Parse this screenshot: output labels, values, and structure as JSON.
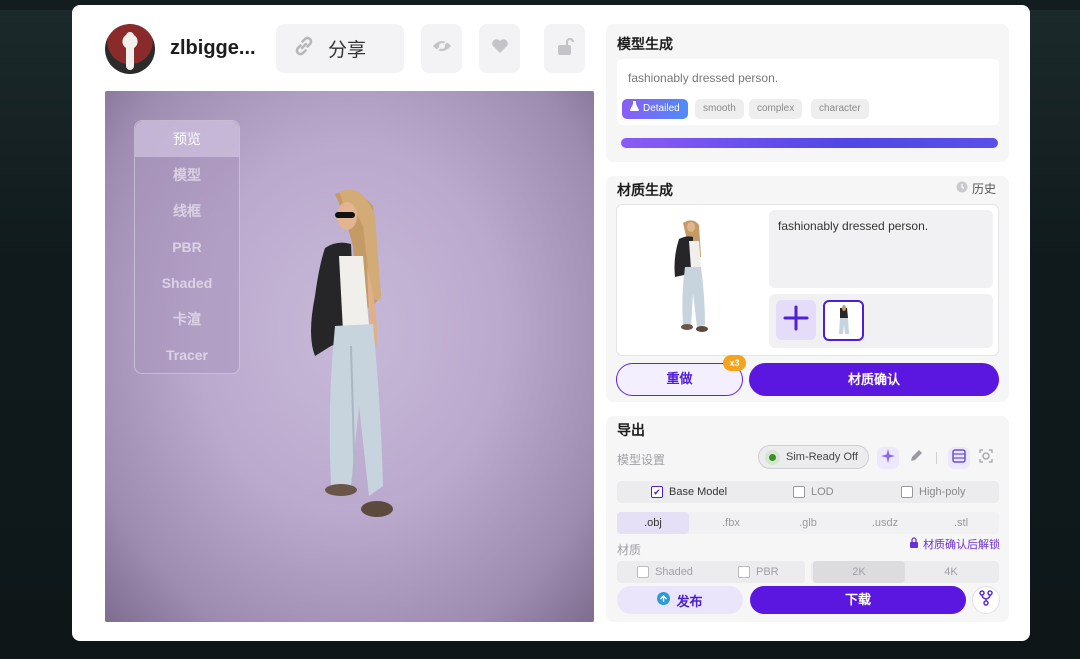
{
  "header": {
    "username": "zlbigge...",
    "share_label": "分享"
  },
  "viewport": {
    "modes": [
      "预览",
      "模型",
      "线框",
      "PBR",
      "Shaded",
      "卡渲",
      "Tracer"
    ],
    "active_mode": "预览"
  },
  "model_gen": {
    "title": "模型生成",
    "prompt": "fashionably dressed person.",
    "tags": [
      "Detailed",
      "smooth",
      "complex",
      "character"
    ],
    "active_tag": "Detailed",
    "progress": 1.0
  },
  "material_gen": {
    "title": "材质生成",
    "history_label": "历史",
    "prompt": "fashionably dressed person.",
    "redo_label": "重做",
    "redo_badge": "x3",
    "confirm_label": "材质确认"
  },
  "export": {
    "title": "导出",
    "model_settings_label": "模型设置",
    "sim_ready_label": "Sim-Ready Off",
    "model_options": [
      {
        "label": "Base Model",
        "checked": true
      },
      {
        "label": "LOD",
        "checked": false
      },
      {
        "label": "High-poly",
        "checked": false
      }
    ],
    "formats": [
      ".obj",
      ".fbx",
      ".glb",
      ".usdz",
      ".stl"
    ],
    "active_format": ".obj",
    "material_label": "材质",
    "unlock_note": "材质确认后解锁",
    "material_options": [
      {
        "label": "Shaded",
        "checked": false
      },
      {
        "label": "PBR",
        "checked": false
      }
    ],
    "resolutions": [
      "2K",
      "4K"
    ],
    "active_resolution": "2K",
    "publish_label": "发布",
    "download_label": "下载"
  },
  "colors": {
    "accent": "#5b16e0",
    "badge": "#f3a31c",
    "viewport_bg": "#bba9cd"
  }
}
